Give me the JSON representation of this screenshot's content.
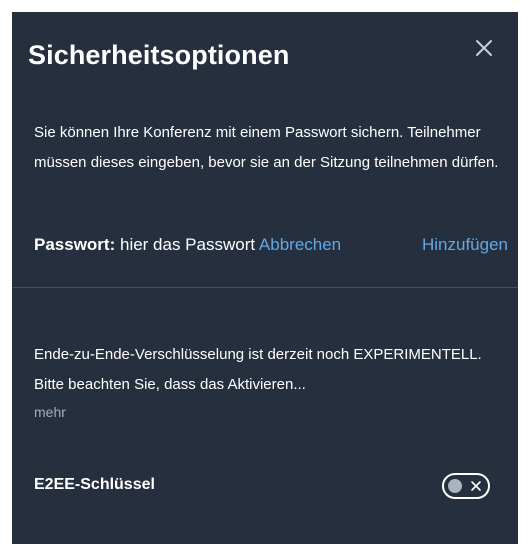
{
  "dialog": {
    "title": "Sicherheitsoptionen",
    "close_icon": "close-icon",
    "description": "Sie können Ihre Konferenz mit einem Passwort sichern. Teilnehmer müssen dieses eingeben, bevor sie an der Sitzung teilnehmen dürfen.",
    "password": {
      "label": "Passwort:",
      "value": "hier das Passwort",
      "cancel_label": "Abbrechen",
      "add_label": "Hinzufügen"
    },
    "e2ee": {
      "description": "Ende-zu-Ende-Verschlüsselung ist derzeit noch EXPERIMENTELL. Bitte beachten Sie, dass das Aktivieren...",
      "more_label": "mehr",
      "key_label": "E2EE-Schlüssel",
      "toggle_on": false
    }
  },
  "colors": {
    "background": "#262f3e",
    "text": "#ffffff",
    "link": "#5fa8e6",
    "muted": "#a3adb9",
    "divider": "#46505e"
  }
}
